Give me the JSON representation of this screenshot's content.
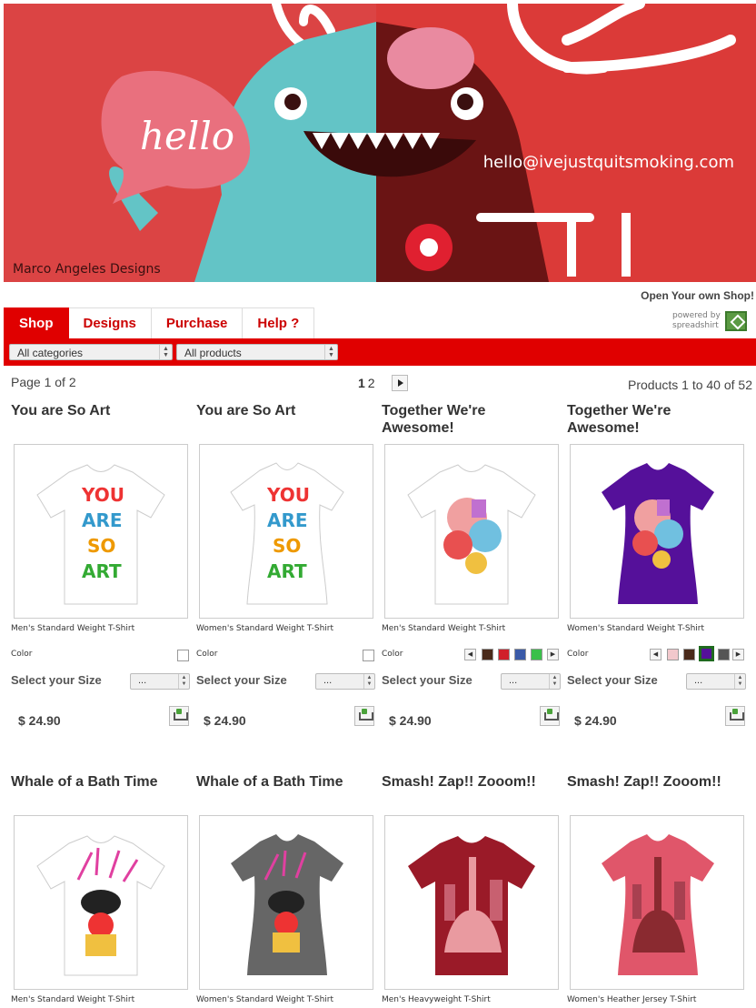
{
  "banner": {
    "brand": "Marco Angeles Designs",
    "email": "hello@ivejustquitsmoking.com",
    "speech": "hello"
  },
  "header": {
    "open_shop": "Open Your own Shop!",
    "powered_by": "powered by",
    "powered_name": "spreadshirt"
  },
  "tabs": [
    {
      "label": "Shop",
      "active": true
    },
    {
      "label": "Designs",
      "active": false
    },
    {
      "label": "Purchase",
      "active": false
    },
    {
      "label": "Help ?",
      "active": false
    }
  ],
  "filters": {
    "category": "All categories",
    "product": "All products"
  },
  "paging": {
    "page_info": "Page 1 of 2",
    "current": "1",
    "next": "2",
    "count_info": "Products 1 to 40 of 52"
  },
  "labels": {
    "color": "Color",
    "select_size": "Select your Size",
    "size_value": "..."
  },
  "products": [
    {
      "title": "You are So Art",
      "type": "Men's Standard Weight T-Shirt",
      "price": "$ 24.90",
      "shirt_color": "#ffffff"
    },
    {
      "title": "You are So Art",
      "type": "Women's Standard Weight T-Shirt",
      "price": "$ 24.90",
      "shirt_color": "#ffffff"
    },
    {
      "title": "Together We're Awesome!",
      "type": "Men's Standard Weight T-Shirt",
      "price": "$ 24.90",
      "shirt_color": "#ffffff",
      "swatches": [
        "#4a2a1a",
        "#d0202a",
        "#3a5aa8",
        "#3ac04a",
        "#666666"
      ]
    },
    {
      "title": "Together We're Awesome!",
      "type": "Women's Standard Weight T-Shirt",
      "price": "$ 24.90",
      "shirt_color": "#55109a",
      "swatches": [
        "#f2c8cc",
        "#4a2a1a",
        "#55109a",
        "#555555"
      ]
    },
    {
      "title": "Whale of a Bath Time",
      "type": "Men's Standard Weight T-Shirt",
      "price": "",
      "shirt_color": "#ffffff"
    },
    {
      "title": "Whale of a Bath Time",
      "type": "Women's Standard Weight T-Shirt",
      "price": "",
      "shirt_color": "#666666"
    },
    {
      "title": "Smash! Zap!! Zooom!!",
      "type": "Men's Heavyweight T-Shirt",
      "price": "",
      "shirt_color": "#9a1a28"
    },
    {
      "title": "Smash! Zap!! Zooom!!",
      "type": "Women's Heather Jersey T-Shirt",
      "price": "",
      "shirt_color": "#e0566a"
    }
  ],
  "colors": {
    "accent": "#e00000",
    "banner_bg": "#d9403a"
  }
}
